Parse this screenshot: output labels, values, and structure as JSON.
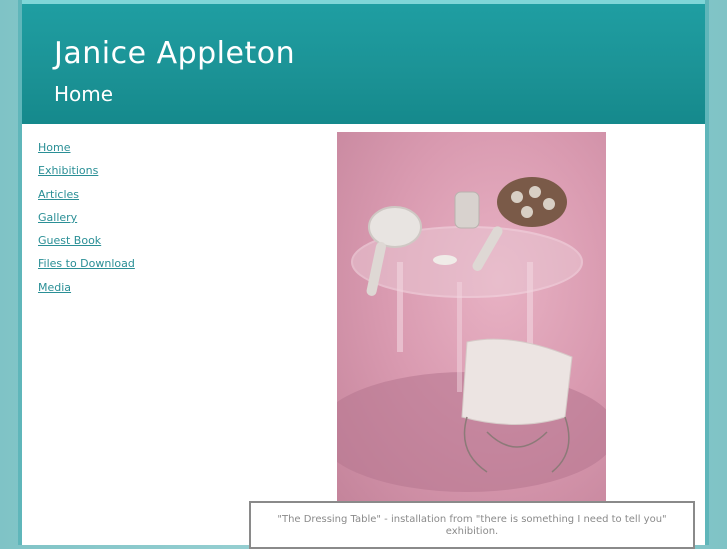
{
  "header": {
    "site_title": "Janice Appleton",
    "page_title": "Home"
  },
  "nav": {
    "items": [
      {
        "label": "Home"
      },
      {
        "label": "Exhibitions"
      },
      {
        "label": "Articles"
      },
      {
        "label": "Gallery"
      },
      {
        "label": "Guest Book"
      },
      {
        "label": "Files to Download"
      },
      {
        "label": "Media"
      }
    ]
  },
  "main": {
    "image_alt": "The Dressing Table installation photo",
    "caption": "\"The Dressing Table\" - installation from \"there is something I need to tell you\" exhibition."
  },
  "colors": {
    "header_bg": "#1b9295",
    "link": "#2a8f96",
    "background": "#7fc3c6"
  }
}
